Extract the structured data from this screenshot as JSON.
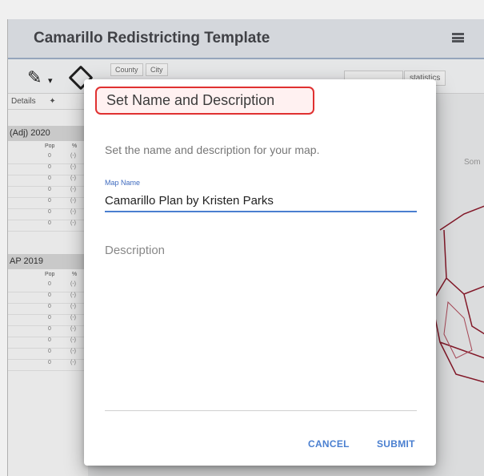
{
  "app": {
    "title": "Camarillo Redistricting Template"
  },
  "toolbar": {
    "tab_county": "County",
    "tab_city": "City",
    "statistics_label": "statistics"
  },
  "sidebar": {
    "details_label": "Details",
    "section1_label": "(Adj) 2020",
    "section2_label": "AP 2019",
    "col_pop": "Pop",
    "col_pct": "%",
    "section1_rows": [
      {
        "value": "0",
        "pct": "(-)"
      },
      {
        "value": "0",
        "pct": "(-)"
      },
      {
        "value": "0",
        "pct": "(-)"
      },
      {
        "value": "0",
        "pct": "(-)"
      },
      {
        "value": "0",
        "pct": "(-)"
      },
      {
        "value": "0",
        "pct": "(-)"
      },
      {
        "value": "0",
        "pct": "(-)"
      }
    ],
    "section2_rows": [
      {
        "value": "0",
        "pct": "(-)"
      },
      {
        "value": "0",
        "pct": "(-)"
      },
      {
        "value": "0",
        "pct": "(-)"
      },
      {
        "value": "0",
        "pct": "(-)"
      },
      {
        "value": "0",
        "pct": "(-)"
      },
      {
        "value": "0",
        "pct": "(-)"
      },
      {
        "value": "0",
        "pct": "(-)"
      },
      {
        "value": "0",
        "pct": "(-)"
      }
    ]
  },
  "map": {
    "label_partial": "Som"
  },
  "dialog": {
    "title": "Set Name and Description",
    "subtitle": "Set the name and description for your map.",
    "map_name_label": "Map Name",
    "map_name_value": "Camarillo Plan by Kristen Parks",
    "description_placeholder": "Description",
    "cancel_label": "CANCEL",
    "submit_label": "SUBMIT"
  },
  "colors": {
    "accent": "#4a7fd0",
    "highlight": "#e03131",
    "district_line": "#8b1a2b"
  },
  "icons": {
    "menu": "menu-icon",
    "pencil": "pencil-icon",
    "shape": "shape-icon"
  }
}
